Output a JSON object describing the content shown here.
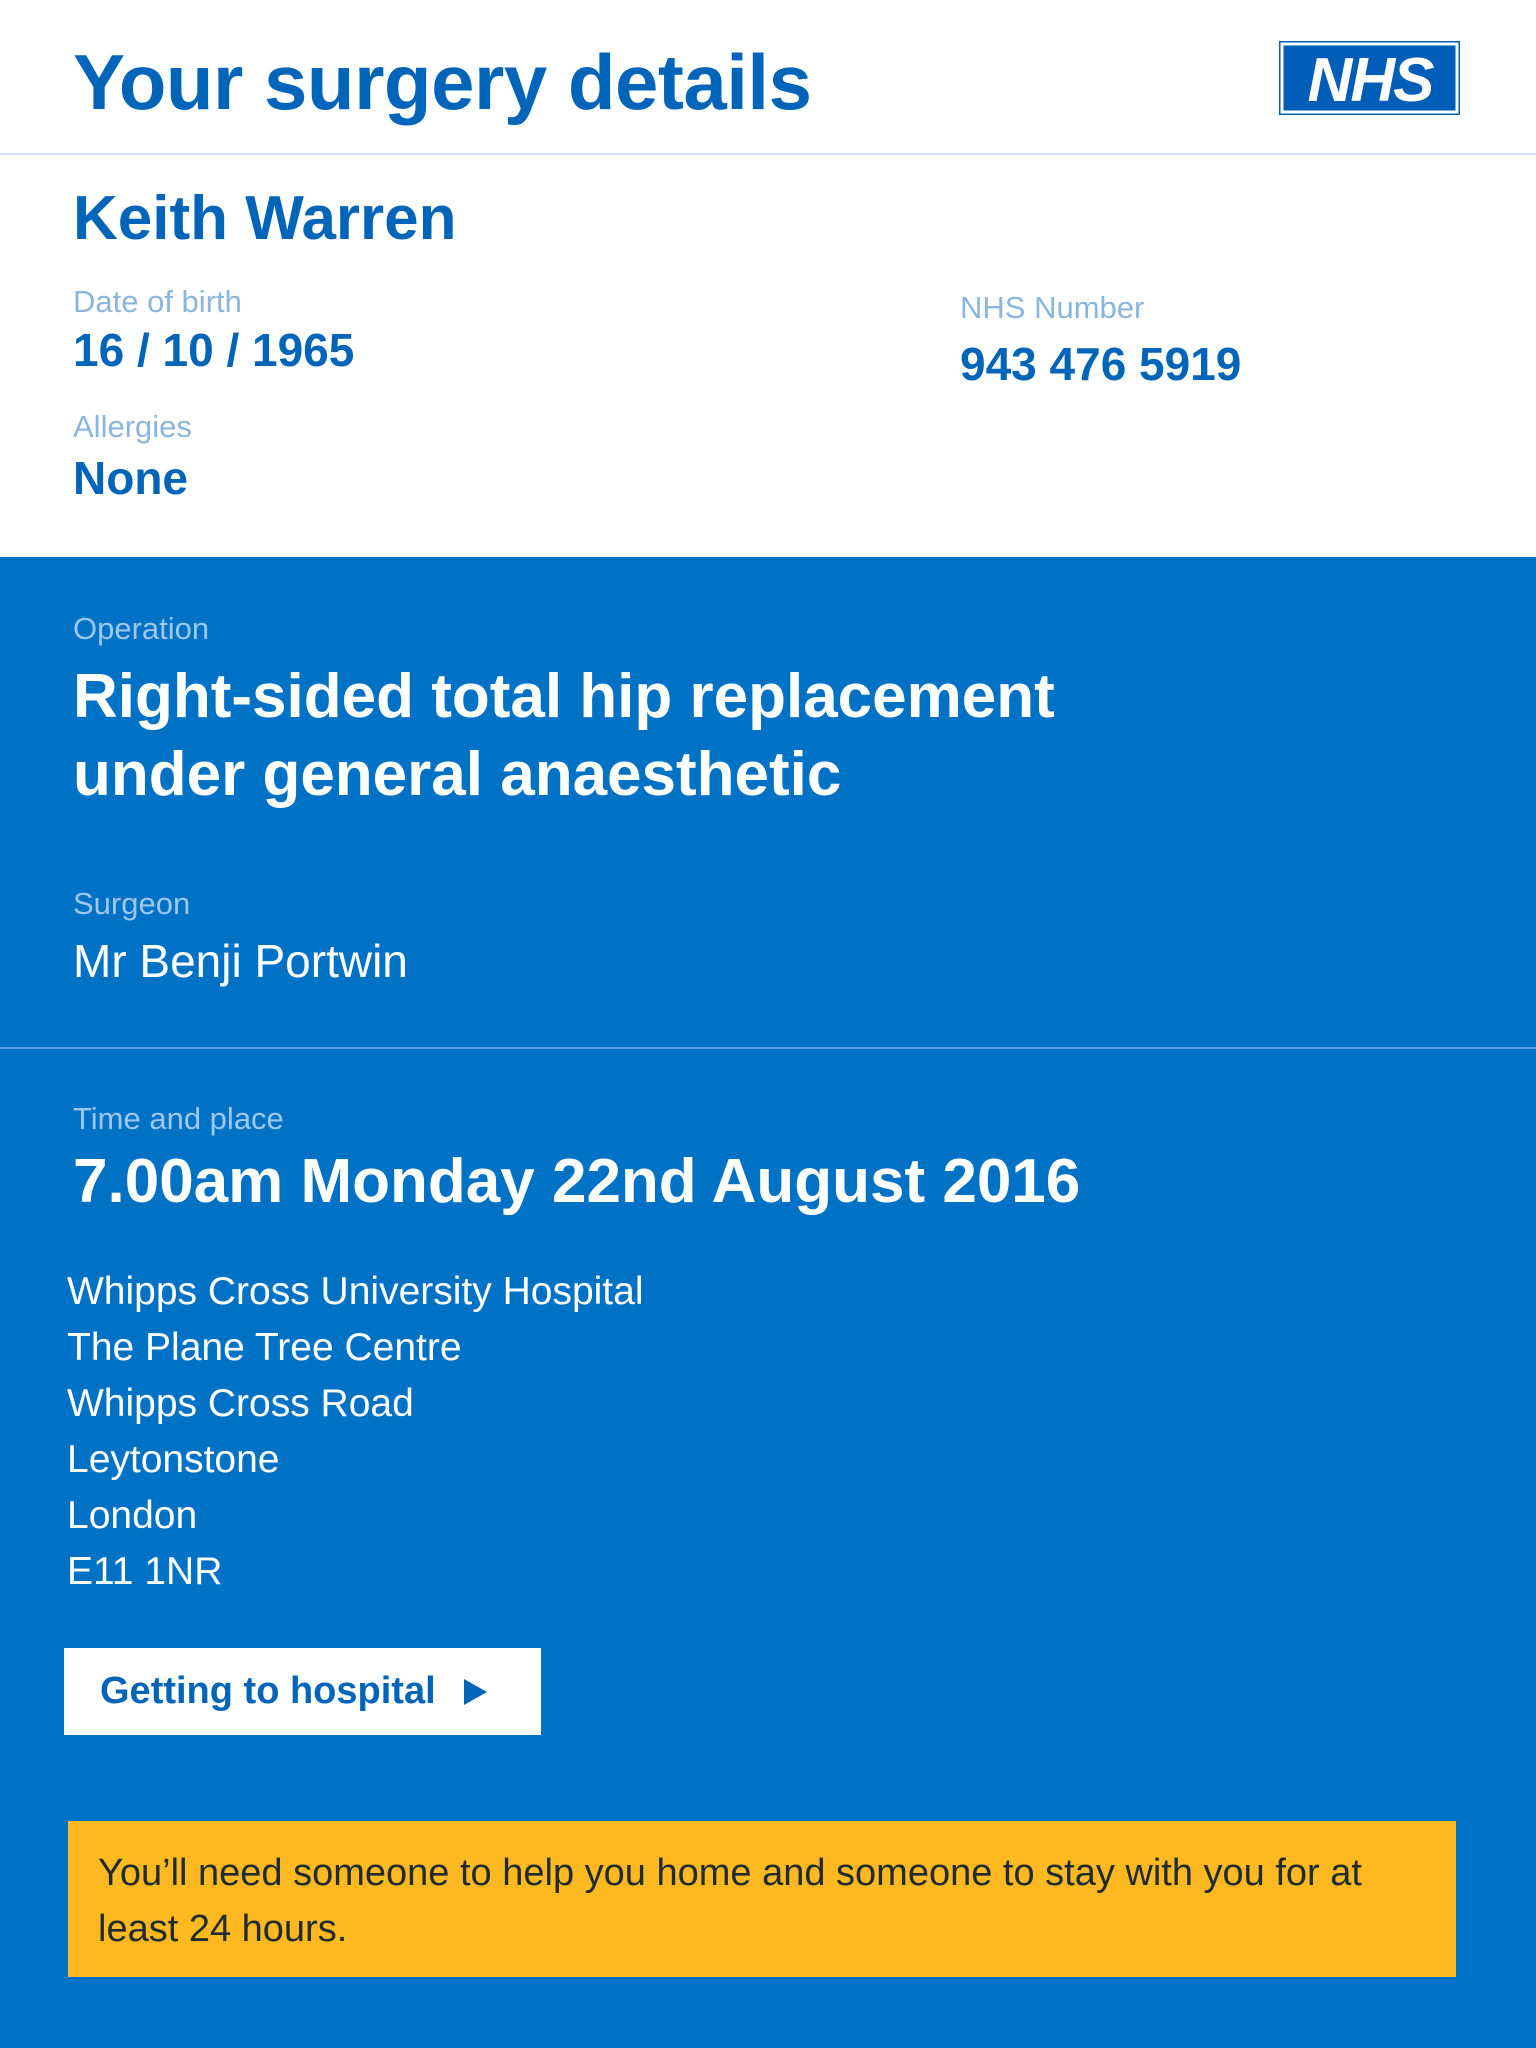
{
  "header": {
    "title": "Your surgery details",
    "logo_text": "NHS"
  },
  "patient": {
    "name": "Keith Warren",
    "dob_label": "Date of birth",
    "dob": "16 / 10 / 1965",
    "nhs_number_label": "NHS Number",
    "nhs_number": "943 476 5919",
    "allergies_label": "Allergies",
    "allergies": "None"
  },
  "operation": {
    "label": "Operation",
    "line1": "Right-sided total hip replacement",
    "line2": "under general anaesthetic",
    "surgeon_label": "Surgeon",
    "surgeon": "Mr Benji Portwin"
  },
  "time_place": {
    "label": "Time and place",
    "datetime": "7.00am Monday 22nd August 2016",
    "address": [
      "Whipps Cross University Hospital",
      "The Plane Tree Centre",
      "Whipps Cross Road",
      "Leytonstone",
      "London",
      "E11 1NR"
    ]
  },
  "cta": {
    "label": "Getting to hospital"
  },
  "warning": {
    "text": "You’ll need someone to help you home and someone to stay with you for at least 24 hours."
  },
  "colors": {
    "nhs_blue": "#005EB8",
    "panel_blue": "#0072C6",
    "warning_yellow": "#FDB91F"
  }
}
